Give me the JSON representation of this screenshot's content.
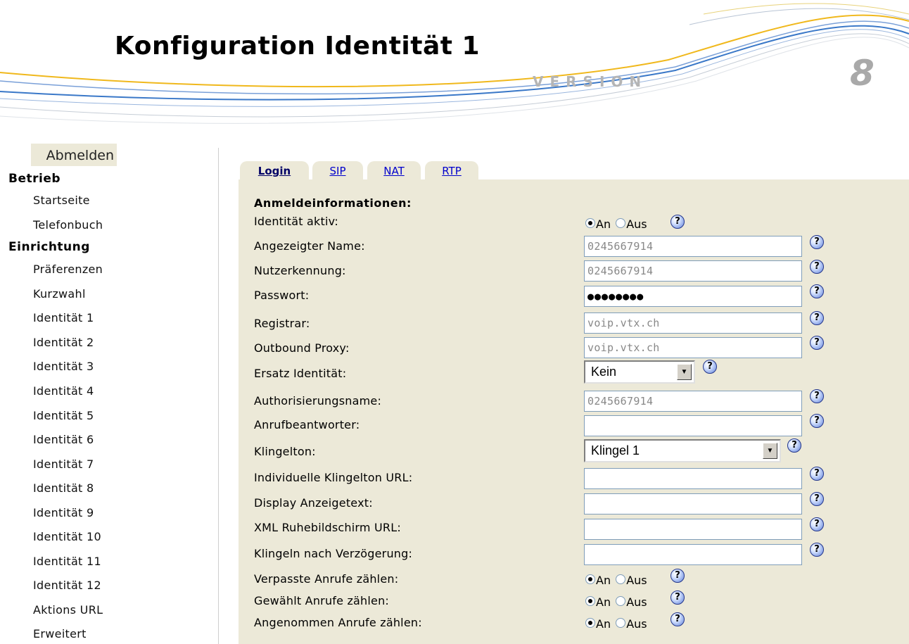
{
  "header": {
    "title": "Konfiguration Identität 1",
    "version_word": "VERSION",
    "version_number": "8"
  },
  "sidebar": {
    "logout_label": "Abmelden",
    "section_betrieb": "Betrieb",
    "section_einrichtung": "Einrichtung",
    "items": [
      "Startseite",
      "Telefonbuch",
      "Präferenzen",
      "Kurzwahl",
      "Identität 1",
      "Identität 2",
      "Identität 3",
      "Identität 4",
      "Identität 5",
      "Identität 6",
      "Identität 7",
      "Identität 8",
      "Identität 9",
      "Identität 10",
      "Identität 11",
      "Identität 12",
      "Aktions URL",
      "Erweitert"
    ]
  },
  "tabs": [
    "Login",
    "SIP",
    "NAT",
    "RTP"
  ],
  "form": {
    "section_title": "Anmeldeinformationen:",
    "radio_on": "An",
    "radio_off": "Aus",
    "help_glyph": "?",
    "identity_active": {
      "label": "Identität aktiv:",
      "value": "An"
    },
    "display_name": {
      "label": "Angezeigter Name:",
      "value": "0245667914"
    },
    "user_id": {
      "label": "Nutzerkennung:",
      "value": "0245667914"
    },
    "password": {
      "label": "Passwort:",
      "value": "●●●●●●●●"
    },
    "registrar": {
      "label": "Registrar:",
      "value": "voip.vtx.ch"
    },
    "outbound_proxy": {
      "label": "Outbound Proxy:",
      "value": "voip.vtx.ch"
    },
    "fallback_identity": {
      "label": "Ersatz Identität:",
      "value": "Kein"
    },
    "auth_name": {
      "label": "Authorisierungsname:",
      "value": "0245667914"
    },
    "voicemail": {
      "label": "Anrufbeantworter:",
      "value": ""
    },
    "ringtone": {
      "label": "Klingelton:",
      "value": "Klingel 1"
    },
    "custom_ringtone_url": {
      "label": "Individuelle Klingelton URL:",
      "value": ""
    },
    "display_text": {
      "label": "Display Anzeigetext:",
      "value": ""
    },
    "xml_idle_url": {
      "label": "XML Ruhebildschirm URL:",
      "value": ""
    },
    "ring_delay": {
      "label": "Klingeln nach Verzögerung:",
      "value": ""
    },
    "count_missed": {
      "label": "Verpasste Anrufe zählen:",
      "value": "An"
    },
    "count_dialed": {
      "label": "Gewählt Anrufe zählen:",
      "value": "An"
    },
    "count_received": {
      "label": "Angenommen Anrufe zählen:",
      "value": "An"
    }
  },
  "colors": {
    "panel_background": "#ece9d8",
    "link_color": "#0000cc",
    "swoosh_blue": "#3a78c8",
    "swoosh_gold": "#f0b81c"
  }
}
